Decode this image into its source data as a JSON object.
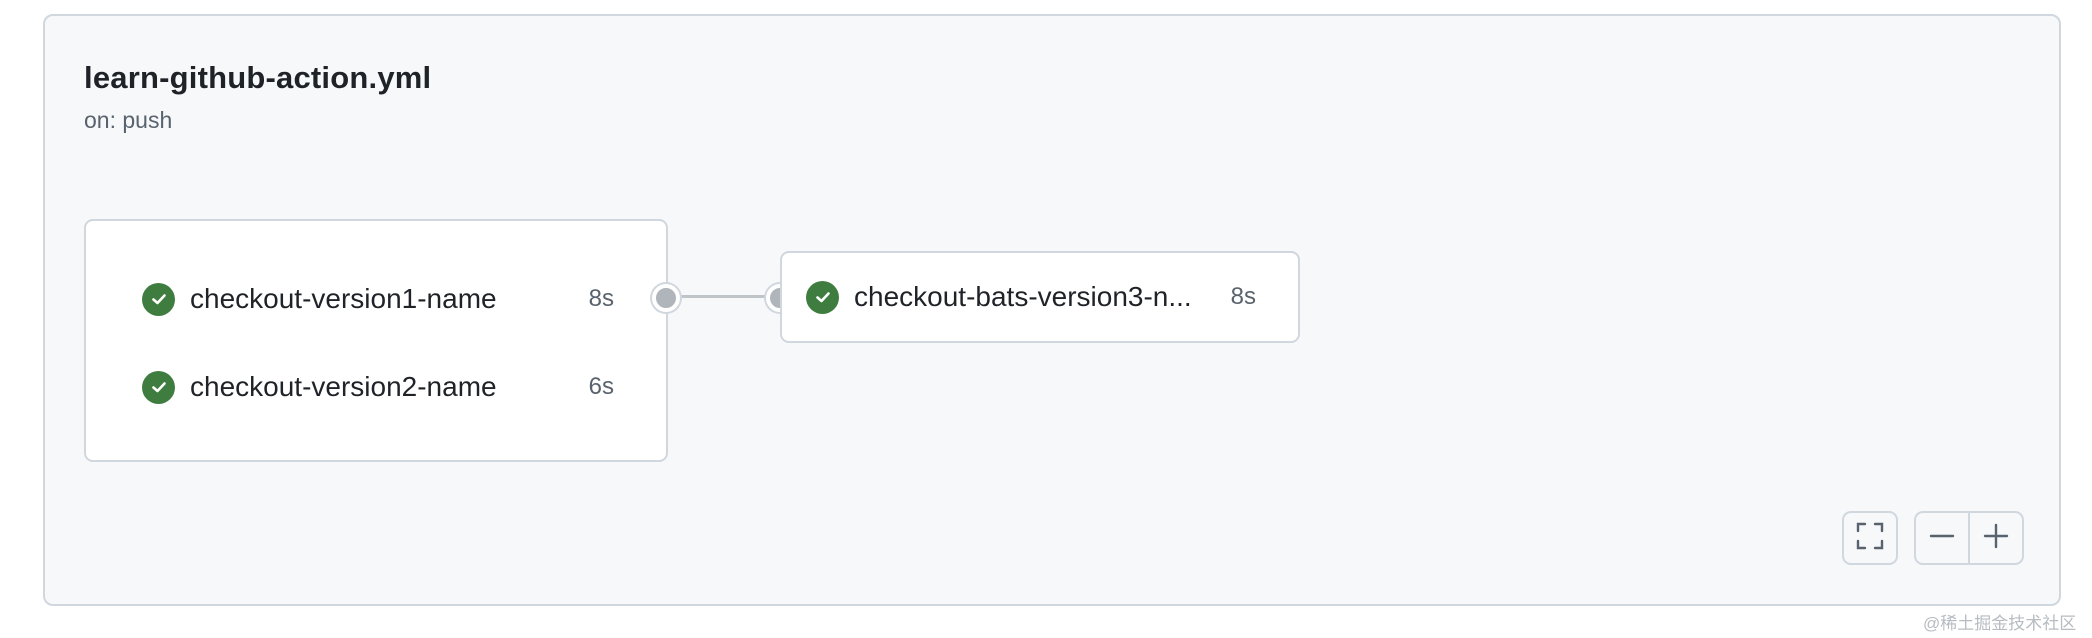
{
  "workflow": {
    "title": "learn-github-action.yml",
    "trigger": "on: push"
  },
  "jobs_group_1": [
    {
      "name": "checkout-version1-name",
      "duration": "8s",
      "status": "success"
    },
    {
      "name": "checkout-version2-name",
      "duration": "6s",
      "status": "success"
    }
  ],
  "jobs_group_2": [
    {
      "name": "checkout-bats-version3-n...",
      "duration": "8s",
      "status": "success"
    }
  ],
  "controls": {
    "fullscreen_icon": "fullscreen-icon",
    "zoom_out_icon": "minus-icon",
    "zoom_in_icon": "plus-icon"
  },
  "watermark": "@稀土掘金技术社区",
  "colors": {
    "success": "#3e7d3f",
    "panel_bg": "#f6f8fa",
    "border": "#d0d7de"
  }
}
